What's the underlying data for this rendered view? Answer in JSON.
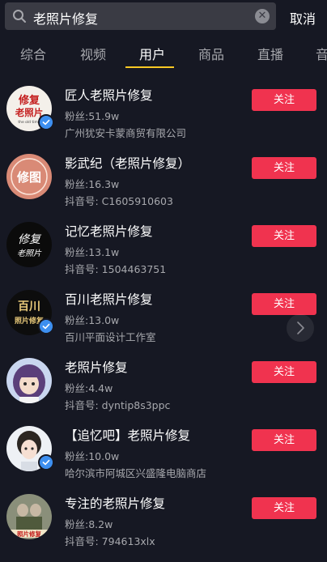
{
  "search": {
    "query": "老照片修复",
    "clear_icon": "clear-icon"
  },
  "cancel_label": "取消",
  "tabs": [
    {
      "label": "综合"
    },
    {
      "label": "视频"
    },
    {
      "label": "用户",
      "active": true
    },
    {
      "label": "商品"
    },
    {
      "label": "直播"
    },
    {
      "label": "音"
    }
  ],
  "users": [
    {
      "name": "匠人老照片修复",
      "fans": "粉丝:51.9w",
      "sub": "广州犹安卡蒙商贸有限公司",
      "verified": true,
      "follow_label": "关注",
      "avatar_text": "修复老照片",
      "avatar_caption": "the old time"
    },
    {
      "name": "影武纪（老照片修复）",
      "fans": "粉丝:16.3w",
      "sub": "抖音号: C1605910603",
      "verified": false,
      "follow_label": "关注",
      "avatar_text": "修图"
    },
    {
      "name": "记忆老照片修复",
      "fans": "粉丝:13.1w",
      "sub": "抖音号: 1504463751",
      "verified": false,
      "follow_label": "关注",
      "avatar_text": "修复老照片"
    },
    {
      "name": "百川老照片修复",
      "fans": "粉丝:13.0w",
      "sub": "百川平面设计工作室",
      "verified": true,
      "follow_label": "关注",
      "avatar_text": "百川照片修复"
    },
    {
      "name": "老照片修复",
      "fans": "粉丝:4.4w",
      "sub": "抖音号: dyntip8s3ppc",
      "verified": false,
      "follow_label": "关注"
    },
    {
      "name": "【追忆吧】老照片修复",
      "fans": "粉丝:10.0w",
      "sub": "哈尔滨市阿城区兴盛隆电脑商店",
      "verified": true,
      "follow_label": "关注"
    },
    {
      "name": "专注的老照片修复",
      "fans": "粉丝:8.2w",
      "sub": "抖音号: 794613xlx",
      "verified": false,
      "follow_label": "关注",
      "avatar_text": "照片修复"
    }
  ],
  "colors": {
    "background": "#161823",
    "follow": "#f0334f",
    "tab_accent": "#f9c824",
    "verified": "#3d8ff0"
  }
}
